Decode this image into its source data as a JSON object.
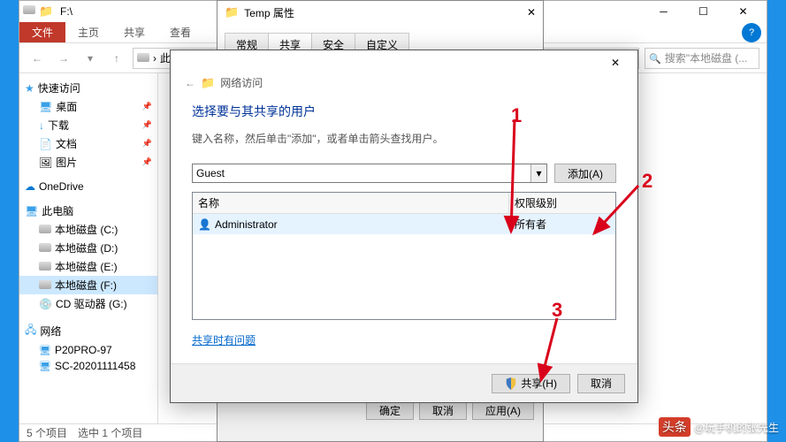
{
  "explorer": {
    "title_path": "F:\\",
    "ribbon": {
      "file": "文件",
      "tabs": [
        "主页",
        "共享",
        "查看"
      ]
    },
    "breadcrumb": "此电脑",
    "search_placeholder": "搜索\"本地磁盘 (...",
    "sidebar": {
      "quick": {
        "label": "快速访问",
        "items": [
          {
            "label": "桌面",
            "icon": "i-desktop"
          },
          {
            "label": "下载",
            "icon": "i-dl"
          },
          {
            "label": "文档",
            "icon": "i-doc"
          },
          {
            "label": "图片",
            "icon": "i-pic"
          }
        ]
      },
      "onedrive": "OneDrive",
      "thispc": {
        "label": "此电脑",
        "drives": [
          {
            "label": "本地磁盘 (C:)"
          },
          {
            "label": "本地磁盘 (D:)"
          },
          {
            "label": "本地磁盘 (E:)"
          },
          {
            "label": "本地磁盘 (F:)",
            "sel": true
          },
          {
            "label": "CD 驱动器 (G:)"
          }
        ]
      },
      "network": {
        "label": "网络",
        "items": [
          "P20PRO-97",
          "SC-20201111458"
        ]
      }
    },
    "status": {
      "count": "5 个项目",
      "sel": "选中 1 个项目"
    }
  },
  "propdlg": {
    "title": "Temp 属性",
    "tabs": [
      "常规",
      "共享",
      "安全",
      "自定义"
    ],
    "active_tab": 1,
    "btns": {
      "ok": "确定",
      "cancel": "取消",
      "apply": "应用(A)"
    }
  },
  "sharedlg": {
    "head": "网络访问",
    "h1": "选择要与其共享的用户",
    "hint": "键入名称，然后单击\"添加\"，或者单击箭头查找用户。",
    "combo_value": "Guest",
    "add_btn": "添加(A)",
    "cols": {
      "name": "名称",
      "perm": "权限级别"
    },
    "rows": [
      {
        "name": "Administrator",
        "perm": "所有者"
      }
    ],
    "link": "共享时有问题",
    "share_btn": "共享(H)",
    "cancel_btn": "取消"
  },
  "annotations": {
    "a1": "1",
    "a2": "2",
    "a3": "3"
  },
  "watermark": {
    "badge": "头条",
    "text": "@玩手机的张先生"
  }
}
